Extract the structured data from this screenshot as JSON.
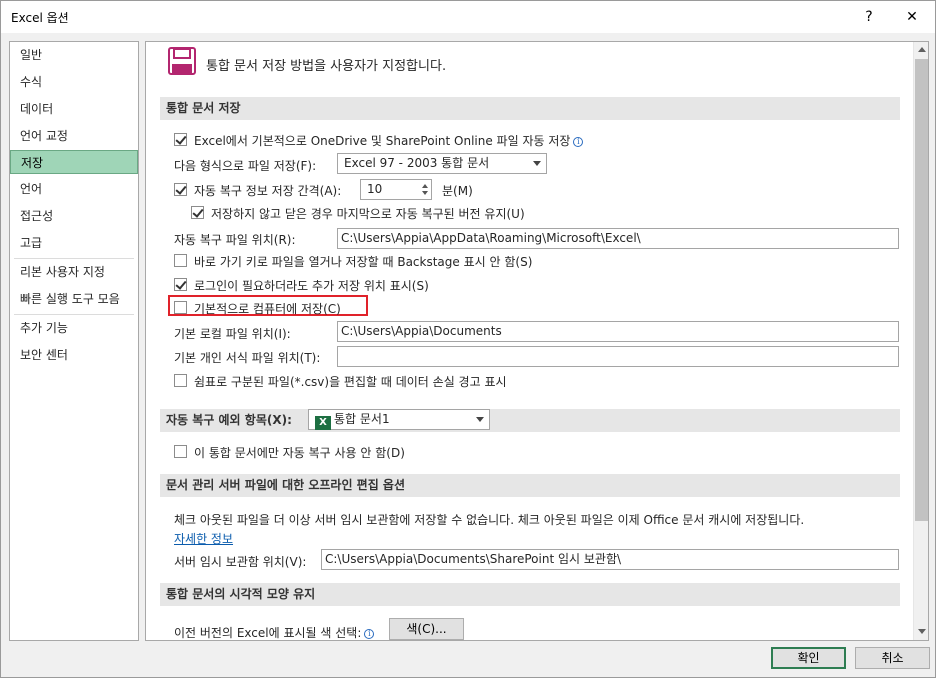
{
  "window": {
    "title": "Excel 옵션",
    "help": "?",
    "close": "✕"
  },
  "nav": {
    "items": [
      {
        "label": "일반"
      },
      {
        "label": "수식"
      },
      {
        "label": "데이터"
      },
      {
        "label": "언어 교정"
      },
      {
        "label": "저장",
        "active": true
      },
      {
        "label": "언어"
      },
      {
        "label": "접근성"
      },
      {
        "label": "고급"
      },
      {
        "label": "리본 사용자 지정"
      },
      {
        "label": "빠른 실행 도구 모음"
      },
      {
        "label": "추가 기능"
      },
      {
        "label": "보안 센터"
      }
    ]
  },
  "header": {
    "text": "통합 문서 저장 방법을 사용자가 지정합니다."
  },
  "save_section": {
    "title": "통합 문서 저장",
    "autosave_label": "Excel에서 기본적으로 OneDrive 및 SharePoint Online 파일 자동 저장",
    "autosave_checked": true,
    "format_label": "다음 형식으로 파일 저장(F):",
    "format_value": "Excel 97 - 2003 통합 문서",
    "autorecover_label": "자동 복구 정보 저장 간격(A):",
    "autorecover_checked": true,
    "autorecover_value": "10",
    "autorecover_unit": "분(M)",
    "keep_last_label": "저장하지 않고 닫은 경우 마지막으로 자동 복구된 버전 유지(U)",
    "keep_last_checked": true,
    "autorecover_location_label": "자동 복구 파일 위치(R):",
    "autorecover_location_value": "C:\\Users\\Appia\\AppData\\Roaming\\Microsoft\\Excel\\",
    "backstage_label": "바로 가기 키로 파일을 열거나 저장할 때 Backstage 표시 안 함(S)",
    "backstage_checked": false,
    "additional_places_label": "로그인이 필요하더라도 추가 저장 위치 표시(S)",
    "additional_places_checked": true,
    "save_to_computer_label": "기본적으로 컴퓨터에 저장(C)",
    "save_to_computer_checked": false,
    "default_local_label": "기본 로컬 파일 위치(I):",
    "default_local_value": "C:\\Users\\Appia\\Documents",
    "default_template_label": "기본 개인 서식 파일 위치(T):",
    "default_template_value": "",
    "csv_warning_label": "쉼표로 구분된 파일(*.csv)을 편집할 때 데이터 손실 경고 표시",
    "csv_warning_checked": false
  },
  "autorecover_exceptions": {
    "title": "자동 복구 예외 항목(X):",
    "workbook_value": "통합 문서1",
    "workbook_icon": "excel-icon",
    "disable_label": "이 통합 문서에만 자동 복구 사용 안 함(D)",
    "disable_checked": false
  },
  "offline_editing": {
    "title": "문서 관리 서버 파일에 대한 오프라인 편집 옵션",
    "description": "체크 아웃된 파일을 더 이상 서버 임시 보관함에 저장할 수 없습니다. 체크 아웃된 파일은 이제 Office 문서 캐시에 저장됩니다.",
    "learn_more": "자세한 정보",
    "server_drafts_label": "서버 임시 보관함 위치(V):",
    "server_drafts_value": "C:\\Users\\Appia\\Documents\\SharePoint 임시 보관함\\"
  },
  "visual_appearance": {
    "title": "통합 문서의 시각적 모양 유지",
    "colors_label": "이전 버전의 Excel에 표시될 색 선택:",
    "colors_button": "색(C)..."
  },
  "footer": {
    "ok": "확인",
    "cancel": "취소"
  },
  "colors": {
    "active_nav": "#9fd5b7",
    "highlight_border": "#e0222a",
    "ok_border": "#2e7d52"
  }
}
